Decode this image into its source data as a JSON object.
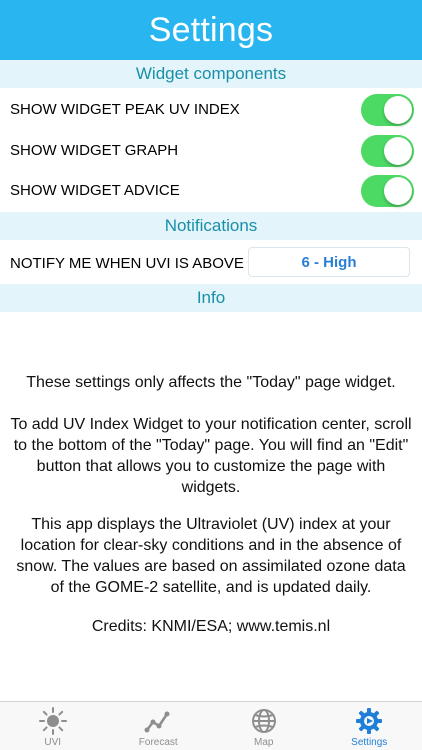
{
  "header": {
    "title": "Settings"
  },
  "widget_section": {
    "title": "Widget components",
    "items": [
      {
        "label": "SHOW WIDGET PEAK UV INDEX",
        "enabled": true
      },
      {
        "label": "SHOW WIDGET GRAPH",
        "enabled": true
      },
      {
        "label": "SHOW WIDGET ADVICE",
        "enabled": true
      }
    ]
  },
  "notifications_section": {
    "title": "Notifications",
    "notify_label": "NOTIFY ME WHEN UVI IS ABOVE",
    "notify_value": "6 - High"
  },
  "info_section": {
    "title": "Info",
    "paragraphs": [
      "These settings only affects the \"Today\" page widget.",
      "To add UV Index Widget to your notification center, scroll to the bottom of the \"Today\" page. You will find an \"Edit\" button that allows you to customize the page with widgets.",
      "This app displays the Ultraviolet (UV) index at your location for clear-sky conditions and in the absence of snow. The values are based on assimilated ozone data of the GOME-2 satellite, and is updated daily.",
      "Credits: KNMI/ESA; www.temis.nl"
    ]
  },
  "tabbar": {
    "tabs": [
      {
        "label": "UVI",
        "icon": "sun-icon",
        "active": false
      },
      {
        "label": "Forecast",
        "icon": "forecast-chart-icon",
        "active": false
      },
      {
        "label": "Map",
        "icon": "globe-icon",
        "active": false
      },
      {
        "label": "Settings",
        "icon": "gear-icon",
        "active": true
      }
    ]
  },
  "colors": {
    "header_bg": "#29b6f0",
    "section_bg": "#e3f4fb",
    "section_text": "#1a8fa8",
    "toggle_on": "#4cd964",
    "accent": "#1f7fd8"
  }
}
